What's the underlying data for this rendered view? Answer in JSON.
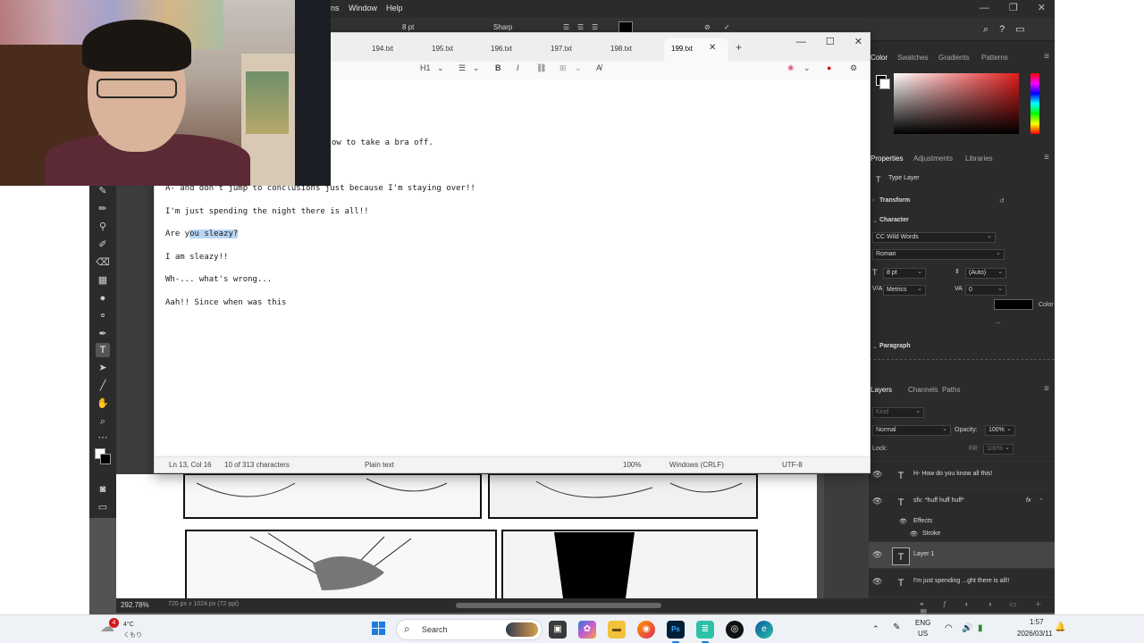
{
  "photoshop": {
    "menu": [
      "ins",
      "Window",
      "Help"
    ],
    "options_bar": {
      "font_size": "8 pt",
      "aa": "Sharp"
    },
    "panels": {
      "color_tabs": [
        "Color",
        "Swatches",
        "Gradients",
        "Patterns"
      ],
      "properties_tabs": [
        "Properties",
        "Adjustments",
        "Libraries"
      ],
      "type_layer": "Type Layer",
      "transform": "Transform",
      "character": "Character",
      "font_family": "CC Wild Words",
      "font_style": "Roman",
      "font_size": "8 pt",
      "leading": "(Auto)",
      "kerning": "Metrics",
      "tracking": "0",
      "color_label": "Color",
      "more": "...",
      "paragraph": "Paragraph",
      "layers_tabs": [
        "Layers",
        "Channels",
        "Paths"
      ],
      "kind": "Kind",
      "blend_mode": "Normal",
      "opacity_label": "Opacity:",
      "opacity_value": "100%",
      "lock_label": "Lock:",
      "fill_label": "Fill:",
      "fill_value": "100%",
      "layers": [
        {
          "name": "H- How do you know all this!",
          "kind": "T"
        },
        {
          "name": "sfx: *huff huff huff*",
          "kind": "T"
        },
        {
          "name": "Effects",
          "kind": "effects"
        },
        {
          "name": "Stroke",
          "kind": "effect"
        },
        {
          "name": "Layer 1",
          "kind": "T"
        },
        {
          "name": "I'm just spending ...ght there is all!!",
          "kind": "T"
        }
      ],
      "fx": "fx"
    },
    "status": {
      "zoom": "292.78%",
      "doc_info": "720 px x 1024 px (72 ppi)"
    }
  },
  "notepad": {
    "tabs": [
      "194.txt",
      "195.txt",
      "196.txt",
      "197.txt",
      "198.txt",
      "199.txt"
    ],
    "toolbar": {
      "heading": "H1",
      "bold": "B",
      "italic": "I"
    },
    "lines": [
      "ow to take a bra off.",
      "A- and don't jump to conclusions just because I'm staying over!!",
      "I'm just spending the night there is all!!",
      "Are you sleazy?",
      "I am sleazy!!",
      "Wh-... what's wrong...",
      "Aah!! Since when was this"
    ],
    "status": {
      "position": "Ln 13, Col 16",
      "chars": "10 of 313 characters",
      "format": "Plain text",
      "zoom": "100%",
      "line_ending": "Windows (CRLF)",
      "encoding": "UTF-8"
    }
  },
  "taskbar": {
    "weather": {
      "temp": "4°C",
      "cond": "くもり",
      "badge": "4"
    },
    "search_placeholder": "Search",
    "tray": {
      "lang": "ENG",
      "region": "US",
      "time": "1:57",
      "date": "2026/03/11"
    }
  }
}
